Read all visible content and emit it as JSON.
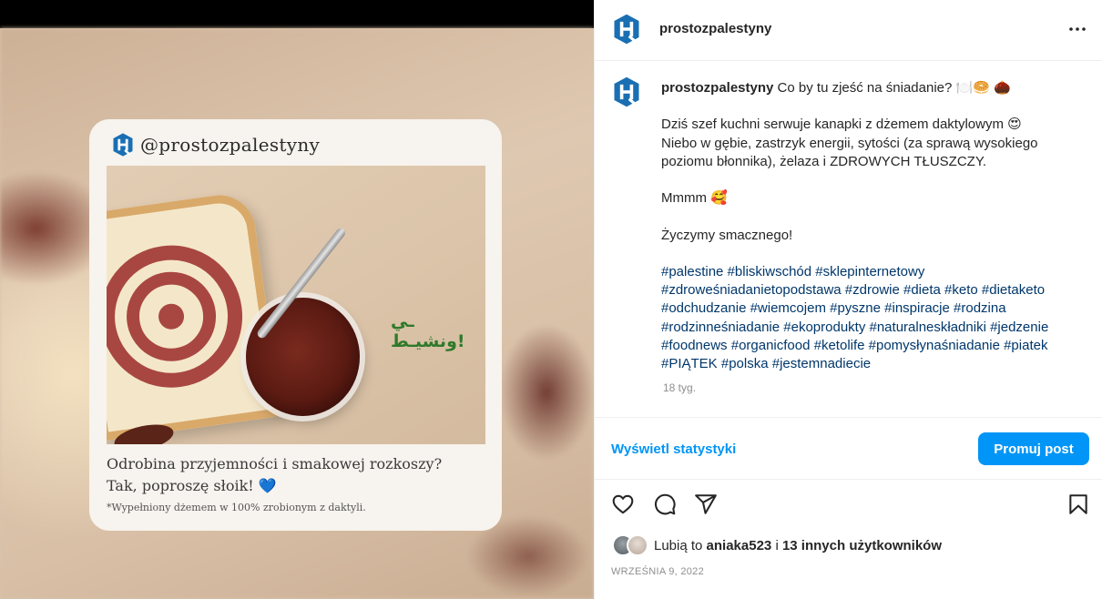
{
  "media": {
    "card": {
      "handle": "@prostozpalestyny",
      "arabic_text": "ـي ونشيـط!",
      "line1": "Odrobina przyjemności i smakowej rozkoszy?",
      "line2": "Tak, poproszę słoik!",
      "heart": "💙",
      "note": "*Wypełniony dżemem w 100% zrobionym z daktyli."
    }
  },
  "header": {
    "username": "prostozpalestyny",
    "more_icon": "more-horizontal-icon"
  },
  "caption": {
    "username": "prostozpalestyny",
    "first_line": "Co by tu zjeść na śniadanie? 🍽️🥯 🌰",
    "p1_l1": "Dziś szef kuchni serwuje kanapki z dżemem daktylowym 😍",
    "p1_l2": "Niebo w gębie, zastrzyk energii, sytości (za sprawą wysokiego poziomu błonnika), żelaza i ZDROWYCH TŁUSZCZY.",
    "mmm": "Mmmm 🥰",
    "wish": "Życzymy smacznego!",
    "hashtags": "#palestine #bliskiwschód #sklepinternetowy #zdroweśniadanietopodstawa #zdrowie #dieta #keto #dietaketo #odchudzanie #wiemcojem #pyszne #inspiracje #rodzina #rodzinneśniadanie #ekoprodukty #naturalneskładniki #jedzenie #foodnews #organicfood #ketolife #pomysłynaśniadanie #piatek #PIĄTEK #polska #jestemnadiecie",
    "time_ago": "18 tyg."
  },
  "stats": {
    "view_label": "Wyświetl statystyki",
    "promote_label": "Promuj post"
  },
  "actions": {
    "icons": [
      "heart-icon",
      "comment-icon",
      "share-icon",
      "bookmark-icon"
    ]
  },
  "likes": {
    "prefix": "Lubią to ",
    "user": "aniaka523",
    "connector": " i ",
    "others": "13 innych użytkowników"
  },
  "post_date": "WRZEŚNIA 9, 2022",
  "colors": {
    "accent": "#0095f6",
    "hashtag": "#00376b",
    "logo": "#1a6fb3"
  }
}
